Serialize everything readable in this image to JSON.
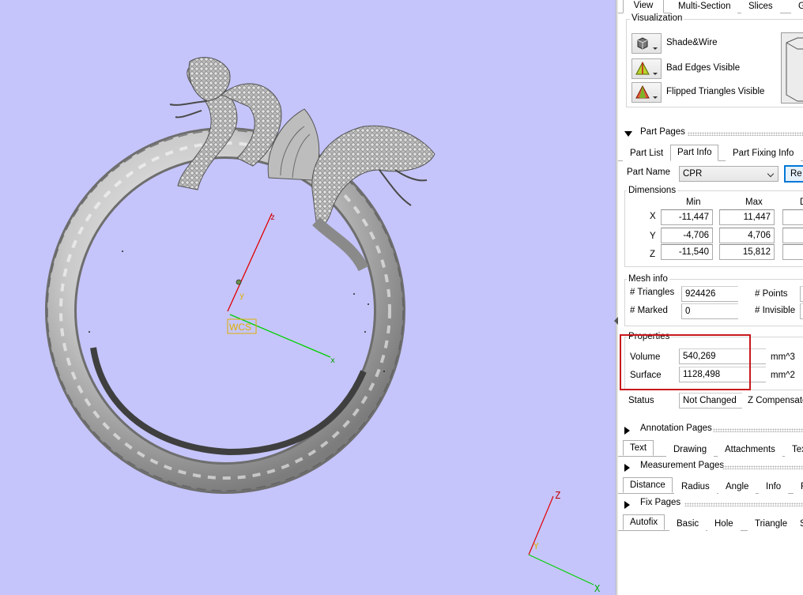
{
  "viewport": {
    "background": "#c5c5fb",
    "wcs_label": "WCS",
    "axis_main": {
      "x": "x",
      "y": "y",
      "z": "z"
    },
    "axis_corner": {
      "y": "Y",
      "z": "Z",
      "x": "X"
    },
    "axis_colors": {
      "x": "#00d000",
      "y": "#e0b000",
      "z": "#e00000"
    }
  },
  "top_tabs": [
    "View",
    "Multi-Section",
    "Slices",
    "G"
  ],
  "visualization": {
    "title": "Visualization",
    "items": [
      {
        "label": "Shade&Wire",
        "icon": "cube-shade-wire-icon"
      },
      {
        "label": "Bad Edges Visible",
        "icon": "bad-edges-triangle-icon"
      },
      {
        "label": "Flipped Triangles Visible",
        "icon": "flipped-triangles-icon"
      }
    ]
  },
  "part_pages": {
    "header": "Part Pages",
    "tabs": [
      "Part List",
      "Part Info",
      "Part Fixing Info"
    ],
    "part_name_label": "Part Name",
    "part_name_value": "CPR",
    "re_button": "Re",
    "dimensions": {
      "title": "Dimensions",
      "col_min": "Min",
      "col_max": "Max",
      "col_delta": "D",
      "rows": [
        {
          "axis": "X",
          "min": "-11,447",
          "max": "11,447"
        },
        {
          "axis": "Y",
          "min": "-4,706",
          "max": "4,706"
        },
        {
          "axis": "Z",
          "min": "-11,540",
          "max": "15,812"
        }
      ]
    },
    "mesh_info": {
      "title": "Mesh info",
      "triangles_label": "# Triangles",
      "triangles_value": "924426",
      "marked_label": "# Marked",
      "marked_value": "0",
      "points_label": "# Points",
      "invisible_label": "# Invisible"
    },
    "properties": {
      "title": "Properties",
      "volume_label": "Volume",
      "volume_value": "540,269",
      "volume_unit": "mm^3",
      "surface_label": "Surface",
      "surface_value": "1128,498",
      "surface_unit": "mm^2"
    },
    "status_label": "Status",
    "status_value": "Not Changed",
    "z_compensate_label": "Z Compensate"
  },
  "annotation_pages": {
    "header": "Annotation Pages",
    "tabs": [
      "Text",
      "Drawing",
      "Attachments",
      "Tex"
    ]
  },
  "measurement_pages": {
    "header": "Measurement Pages",
    "tabs": [
      "Distance",
      "Radius",
      "Angle",
      "Info",
      "F"
    ]
  },
  "fix_pages": {
    "header": "Fix Pages",
    "tabs": [
      "Autofix",
      "Basic",
      "Hole",
      "Triangle",
      "S"
    ]
  }
}
